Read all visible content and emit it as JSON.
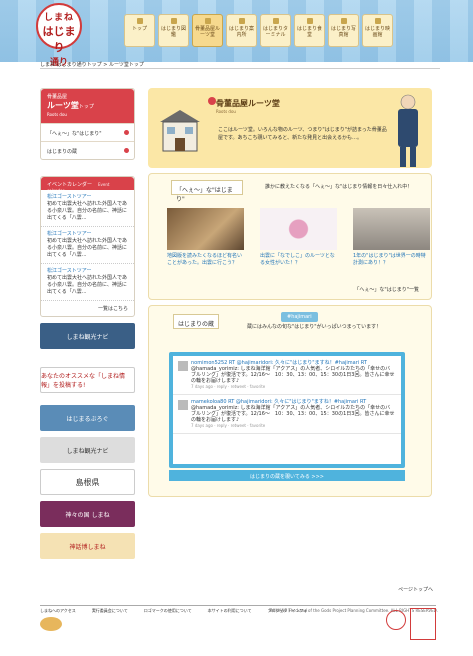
{
  "logo": {
    "line1": "しまね",
    "line2": "はじまり",
    "line3": "通り"
  },
  "nav": [
    {
      "label": "トップ"
    },
    {
      "label": "はじまり図鑑"
    },
    {
      "label": "骨董品屋ルーツ堂"
    },
    {
      "label": "はじまり案内所"
    },
    {
      "label": "はじまりターミナル"
    },
    {
      "label": "はじまり食堂"
    },
    {
      "label": "はじまり写真館"
    },
    {
      "label": "はじまり映画館"
    }
  ],
  "breadcrumb": {
    "home": "しまね はじまり通りトップ",
    "sep": ">",
    "current": "ルーツ堂トップ"
  },
  "sidebar": {
    "kicker": "骨董品屋",
    "title": "ルーツ堂",
    "title_suffix": "トップ",
    "en": "Roots dou",
    "items": [
      {
        "label": "「へぇ～」な\"はじまり\""
      },
      {
        "label": "はじまりの蔵"
      }
    ]
  },
  "calendar": {
    "heading": "イベントカレンダー",
    "heading_en": "Event calendar",
    "events": [
      {
        "title": "松江ゴーストツアー",
        "text": "初めて出雲大社へ訪れた外国人である小泉八雲。自分の名前に、神話に出てくる「八雲..."
      },
      {
        "title": "松江ゴーストツアー",
        "text": "初めて出雲大社へ訪れた外国人である小泉八雲。自分の名前に、神話に出てくる「八雲..."
      },
      {
        "title": "松江ゴーストツアー",
        "text": "初めて出雲大社へ訪れた外国人である小泉八雲。自分の名前に、神話に出てくる「八雲..."
      }
    ],
    "more": "一覧はこちら"
  },
  "banners": [
    {
      "label": "しまね観光ナビ"
    },
    {
      "label": "あなたのオススメな「しまね情報」を投稿する!"
    },
    {
      "label": "はじまるぶろぐ"
    },
    {
      "label": "しまね観光ナビ"
    },
    {
      "label": "島根県"
    },
    {
      "label": "神々の国 しまね"
    },
    {
      "label": "神話博しまね"
    }
  ],
  "main": {
    "title": "骨董品屋ルーツ堂",
    "title_en": "Roots dou",
    "desc": "ここはルーツ堂。いろんな物のルーツ、つまり\"はじまり\"が詰まった骨董品屋です。あちこち覗いてみると、新たな発見と出会えるかも…。",
    "section1": {
      "tag": "「へぇ～」な\"はじまり\"",
      "question": "誰かに教えたくなる「へぇ～」な\"はじまり情報を日々仕入れ中！",
      "cards": [
        {
          "caption": "地図版を読みたくなるほど有名いことがあった。出雲に行こう？"
        },
        {
          "caption": "出雲に「なでしこ」のルーツとなる女性がいた！？"
        },
        {
          "caption": "1年の\"はじまり\"は世界一の時特計測にあり！？"
        }
      ],
      "link": "「へぇ～」な\"はじまり\"一覧"
    },
    "section2": {
      "tag": "はじまりの蔵",
      "hashtag": "#hajimari",
      "intro": "蔵にはみんなの旬な\"はじまり\"がいっぱいつまっています！",
      "tweets": [
        {
          "user": "nomimon5252 RT @hajimaridori: 久々に\"はじまり\"ますね！#hajimari RT",
          "text": "@hamada_yorimiz: しまね海洋館「アクアス」の人気者、シロイルカたちの「幸せのバブルリング」が復活です。12/16～　10：30、13：00、15：30の1日3回。皆さんに幸せの輪をお届けします♪",
          "meta": "7 days ago · reply · retweet · favorite"
        },
        {
          "user": "mamekoloa80 RT @hajimaridori: 久々に\"はじまり\"ますね！#hajimari RT",
          "text": "@hamada_yorimiz: しまね海洋館「アクアス」の人気者、シロイルカたちの「幸せのバブルリング」が復活です。12/16～　10：30、13：00、15：30の1日3回。皆さんに幸せの輪をお届けします♪",
          "meta": "7 days ago · reply · retweet · favorite"
        }
      ],
      "button": "はじまりの蔵を覗いてみる >>>"
    }
  },
  "page_top": "ページトップへ",
  "footer": {
    "links": [
      "しまねへのアクセス",
      "実行委員会について",
      "ロゴマークの使用について",
      "本サイトの利用について",
      "プロジェクトインフォ"
    ],
    "copyright": "SHIMANE The Land of the Gods Project Planning Committee. ALL RIGHTS RESERVED."
  }
}
